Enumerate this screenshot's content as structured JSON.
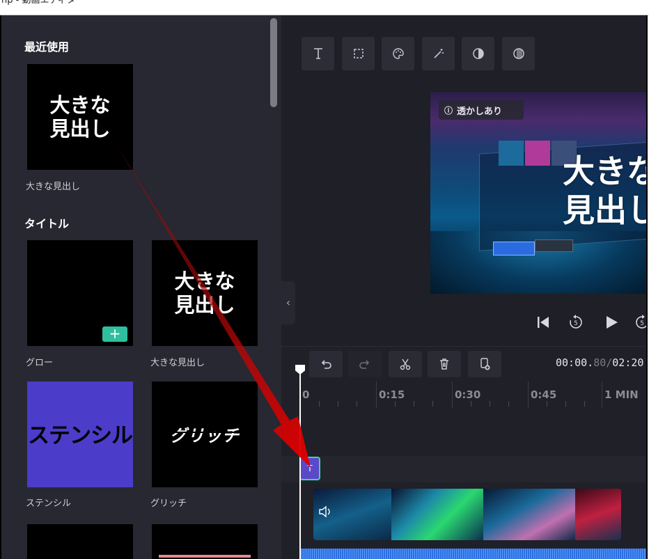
{
  "window": {
    "title": "np - 動画エディター"
  },
  "sidebar": {
    "recent_heading": "最近使用",
    "recent_card": {
      "text_line1": "大きな",
      "text_line2": "見出し",
      "caption": "大きな見出し"
    },
    "title_heading": "タイトル",
    "cards": [
      {
        "caption": "グロー",
        "plus": "+"
      },
      {
        "text_line1": "大きな",
        "text_line2": "見出し",
        "caption": "大きな見出し"
      },
      {
        "text": "ステンシル",
        "caption": "ステンシル"
      },
      {
        "text": "グリッチ",
        "caption": "グリッチ"
      }
    ]
  },
  "preview": {
    "watermark_label": "透かしあり",
    "overlay_line1": "大きな",
    "overlay_line2": "見出し"
  },
  "timeline": {
    "timecode_current_main": "00:00.",
    "timecode_current_fraction": "80",
    "timecode_separator": "/",
    "timecode_total": "02:20",
    "ruler_labels": [
      "0",
      "0:15",
      "0:30",
      "0:45",
      "1 MIN"
    ],
    "text_clip_label": "T"
  },
  "colors": {
    "accent_teal": "#2fbf9f",
    "stencil_purple": "#4b3cc9",
    "arrow_red": "#e00000"
  }
}
